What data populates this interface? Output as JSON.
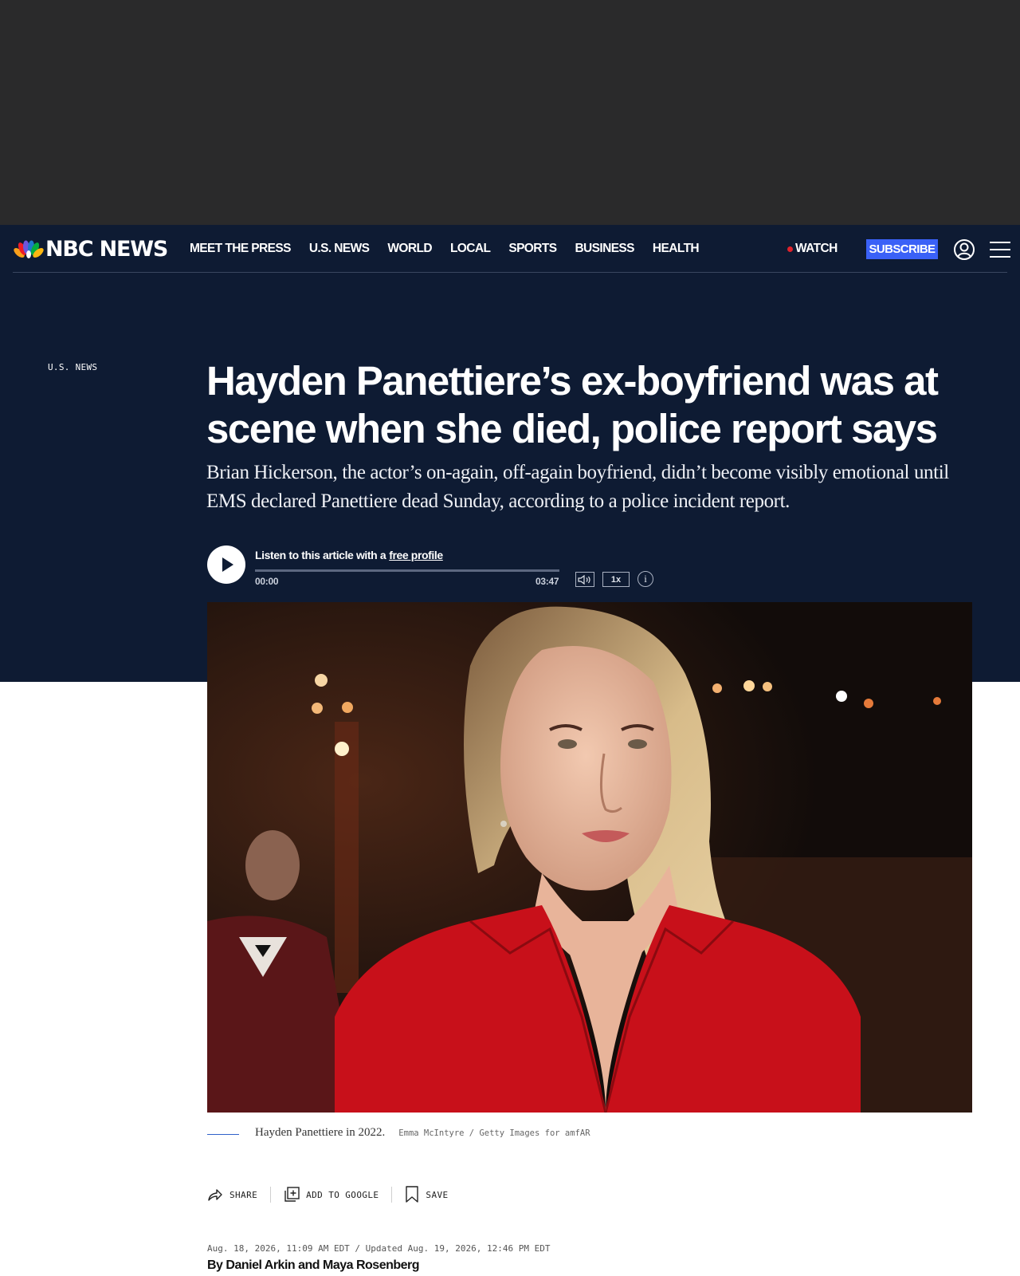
{
  "site": {
    "logo_text": "NBC NEWS"
  },
  "nav": {
    "links": [
      "MEET THE PRESS",
      "U.S. NEWS",
      "WORLD",
      "LOCAL",
      "SPORTS",
      "BUSINESS",
      "HEALTH"
    ],
    "watch_label": "WATCH",
    "subscribe_label": "SUBSCRIBE",
    "icons": {
      "account": "account-icon",
      "menu": "hamburger-menu-icon"
    }
  },
  "colors": {
    "header_bg": "#0e1b33",
    "ad_bg": "#2a2a2b",
    "subscribe_bg": "#3a61f7",
    "live_dot": "#e0222b"
  },
  "article": {
    "section": "U.S. NEWS",
    "headline": "Hayden Panettiere’s ex-boyfriend was at scene when she died, police report says",
    "dek": "Brian Hickerson, the actor’s on-again, off-again boyfriend, didn’t become visibly emotional until EMS declared Panettiere dead Sunday, according to a police incident report.",
    "audio": {
      "prompt": "Listen to this article with a",
      "link": "free profile",
      "time_start": "00:00",
      "time_end": "03:47",
      "progress": 0.0,
      "speed": "1x",
      "info": "i"
    },
    "photo": {
      "caption": "Hayden Panettiere in 2022.",
      "credit": "Emma McIntyre / Getty Images for amfAR"
    },
    "actions": [
      "SHARE",
      "ADD TO GOOGLE",
      "SAVE"
    ],
    "dateline": "Aug. 18, 2026, 11:09 AM EDT / Updated Aug. 19, 2026, 12:46 PM EDT",
    "byline": "By Daniel Arkin and Maya Rosenberg"
  }
}
